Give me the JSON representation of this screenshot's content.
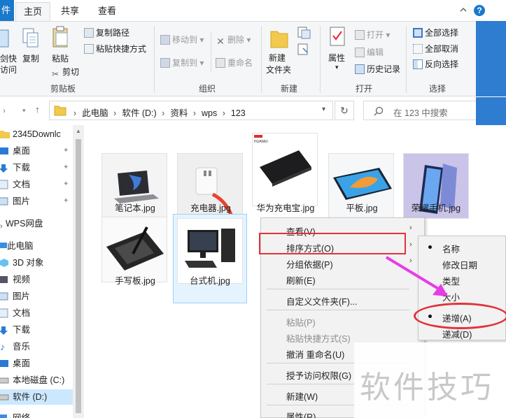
{
  "tabs": {
    "file": "件",
    "home": "主页",
    "share": "共享",
    "view": "查看"
  },
  "ribbon": {
    "clipboard": {
      "pin": "剑快",
      "pin2": "访问",
      "copy": "复制",
      "paste": "粘贴",
      "copy_path": "复制路径",
      "paste_shortcut": "粘贴快捷方式",
      "cut": "剪切",
      "label": "剪贴板"
    },
    "organize": {
      "move_to": "移动到",
      "copy_to": "复制到",
      "delete": "删除",
      "rename": "重命名",
      "label": "组织"
    },
    "new": {
      "new_folder_1": "新建",
      "new_folder_2": "文件夹",
      "label": "新建"
    },
    "open": {
      "properties": "属性",
      "open": "打开",
      "edit": "编辑",
      "history": "历史记录",
      "label": "打开"
    },
    "select": {
      "select_all": "全部选择",
      "select_none": "全部取消",
      "invert": "反向选择",
      "label": "选择"
    }
  },
  "address": {
    "crumbs": [
      "此电脑",
      "软件 (D:)",
      "资料",
      "wps",
      "123"
    ]
  },
  "search": {
    "placeholder": "在 123 中搜索"
  },
  "sidebar": {
    "items": [
      {
        "label": "2345Downlc",
        "icon": "folder-icon"
      },
      {
        "label": "桌面",
        "icon": "desktop-icon"
      },
      {
        "label": "下载",
        "icon": "download-icon"
      },
      {
        "label": "文档",
        "icon": "document-icon"
      },
      {
        "label": "图片",
        "icon": "picture-icon"
      },
      {
        "label": "WPS网盘",
        "icon": "cloud-icon"
      },
      {
        "label": "此电脑",
        "icon": "computer-icon"
      },
      {
        "label": "3D 对象",
        "icon": "3d-objects-icon"
      },
      {
        "label": "视频",
        "icon": "video-icon"
      },
      {
        "label": "图片",
        "icon": "picture-icon"
      },
      {
        "label": "文档",
        "icon": "document-icon"
      },
      {
        "label": "下载",
        "icon": "download-icon"
      },
      {
        "label": "音乐",
        "icon": "music-icon"
      },
      {
        "label": "桌面",
        "icon": "desktop-icon"
      },
      {
        "label": "本地磁盘 (C:)",
        "icon": "drive-icon"
      },
      {
        "label": "软件 (D:)",
        "icon": "drive-icon"
      },
      {
        "label": "网络",
        "icon": "network-icon"
      }
    ]
  },
  "files": [
    {
      "name": "笔记本.jpg"
    },
    {
      "name": "充电器.jpg"
    },
    {
      "name": "华为充电宝.jpg",
      "brand": "HUAWEI"
    },
    {
      "name": "平板.jpg"
    },
    {
      "name": "荣耀手机.jpg"
    },
    {
      "name": "手写板.jpg"
    },
    {
      "name": "台式机.jpg"
    }
  ],
  "context_menu": {
    "view": "查看(V)",
    "sort_by": "排序方式(O)",
    "group_by": "分组依据(P)",
    "refresh": "刷新(E)",
    "customize": "自定义文件夹(F)...",
    "paste": "粘贴(P)",
    "paste_shortcut": "粘贴快捷方式(S)",
    "undo_rename": "撤消 重命名(U)",
    "give_access": "授予访问权限(G)",
    "new": "新建(W)",
    "properties": "属性(R)"
  },
  "sort_submenu": {
    "name": "名称",
    "date": "修改日期",
    "type": "类型",
    "size": "大小",
    "ascending": "递增(A)",
    "descending": "递减(D)"
  },
  "watermark": "软件技巧",
  "colors": {
    "accent": "#1979ca",
    "highlight": "#e2323c",
    "arrow": "#e83be8"
  }
}
